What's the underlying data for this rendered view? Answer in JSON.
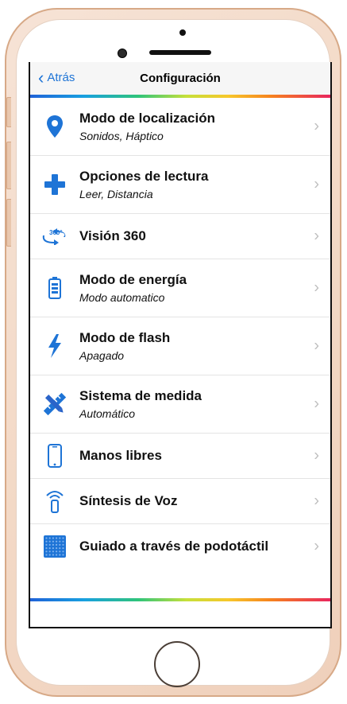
{
  "colors": {
    "accent": "#1e74d6",
    "phone_body": "#f3d9c6",
    "rainbow": [
      "#1f62d8",
      "#18a0e0",
      "#2fc47a",
      "#c6e03a",
      "#f7c72b",
      "#f6831e",
      "#e8265e"
    ]
  },
  "nav": {
    "back_label": "Atrás",
    "title": "Configuración"
  },
  "items": [
    {
      "label": "Modo de localización",
      "sub": "Sonidos, Háptico",
      "icon": "location-pin-icon"
    },
    {
      "label": "Opciones de lectura",
      "sub": "Leer, Distancia",
      "icon": "plus-icon"
    },
    {
      "label": "Visión 360",
      "sub": "",
      "icon": "rotate-360-icon"
    },
    {
      "label": "Modo de energía",
      "sub": "Modo automatico",
      "icon": "battery-icon"
    },
    {
      "label": "Modo de flash",
      "sub": "Apagado",
      "icon": "flash-icon"
    },
    {
      "label": "Sistema de medida",
      "sub": "Automático",
      "icon": "ruler-pencil-icon"
    },
    {
      "label": "Manos libres",
      "sub": "",
      "icon": "phone-icon"
    },
    {
      "label": "Síntesis de Voz",
      "sub": "",
      "icon": "voice-signal-icon"
    },
    {
      "label": "Guiado a través de podotáctil",
      "sub": "",
      "icon": "tactile-grid-icon"
    }
  ]
}
